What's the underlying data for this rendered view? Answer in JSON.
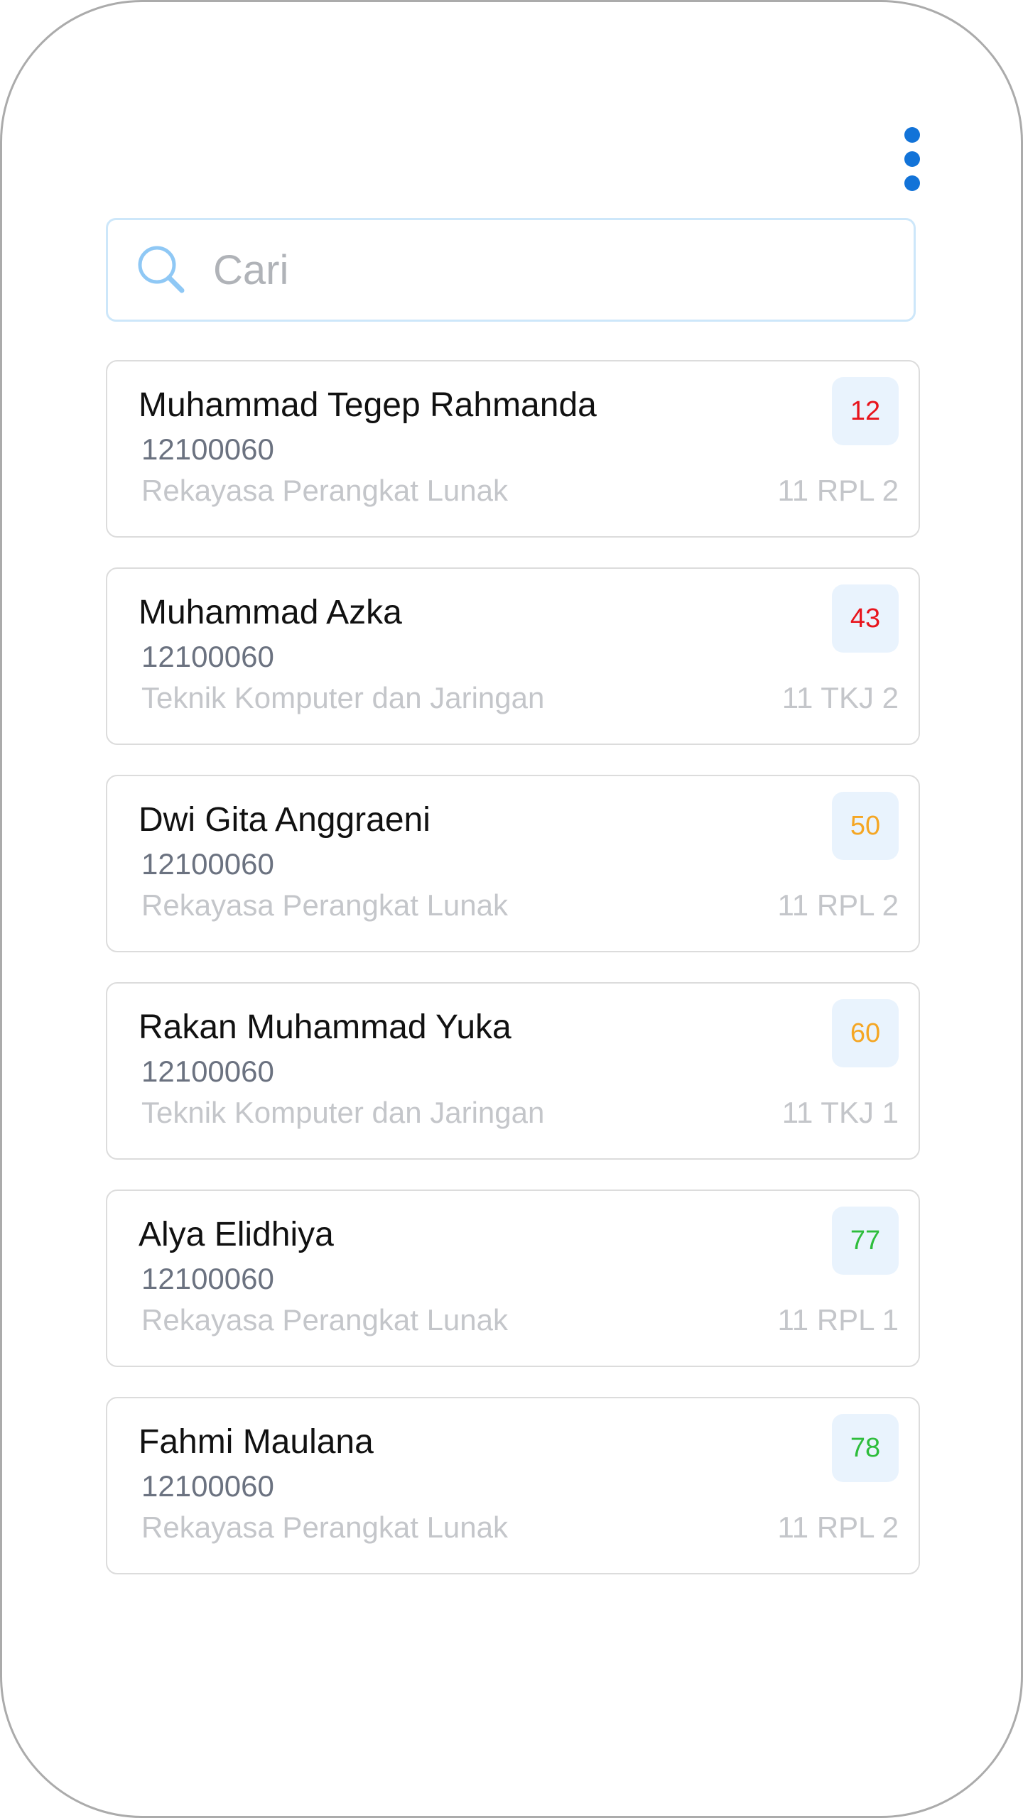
{
  "search": {
    "placeholder": "Cari",
    "value": ""
  },
  "menu": {
    "icon": "more-vertical-icon",
    "color": "#1273d8"
  },
  "colors": {
    "score_low": "#e8141c",
    "score_mid": "#f5a623",
    "score_high": "#2ebd3c",
    "badge_bg": "#e9f3fd"
  },
  "students": [
    {
      "name": "Muhammad Tegep Rahmanda",
      "id": "12100060",
      "major": "Rekayasa Perangkat Lunak",
      "class": "11 RPL 2",
      "score": "12",
      "score_color": "#e8141c"
    },
    {
      "name": "Muhammad Azka",
      "id": "12100060",
      "major": "Teknik Komputer dan Jaringan",
      "class": "11 TKJ 2",
      "score": "43",
      "score_color": "#e8141c"
    },
    {
      "name": "Dwi Gita Anggraeni",
      "id": "12100060",
      "major": "Rekayasa Perangkat Lunak",
      "class": "11 RPL 2",
      "score": "50",
      "score_color": "#f5a623"
    },
    {
      "name": "Rakan Muhammad Yuka",
      "id": "12100060",
      "major": "Teknik Komputer dan Jaringan",
      "class": "11 TKJ 1",
      "score": "60",
      "score_color": "#f5a623"
    },
    {
      "name": "Alya Elidhiya",
      "id": "12100060",
      "major": "Rekayasa Perangkat Lunak",
      "class": "11 RPL 1",
      "score": "77",
      "score_color": "#2ebd3c"
    },
    {
      "name": "Fahmi Maulana",
      "id": "12100060",
      "major": "Rekayasa Perangkat Lunak",
      "class": "11 RPL 2",
      "score": "78",
      "score_color": "#2ebd3c"
    }
  ]
}
